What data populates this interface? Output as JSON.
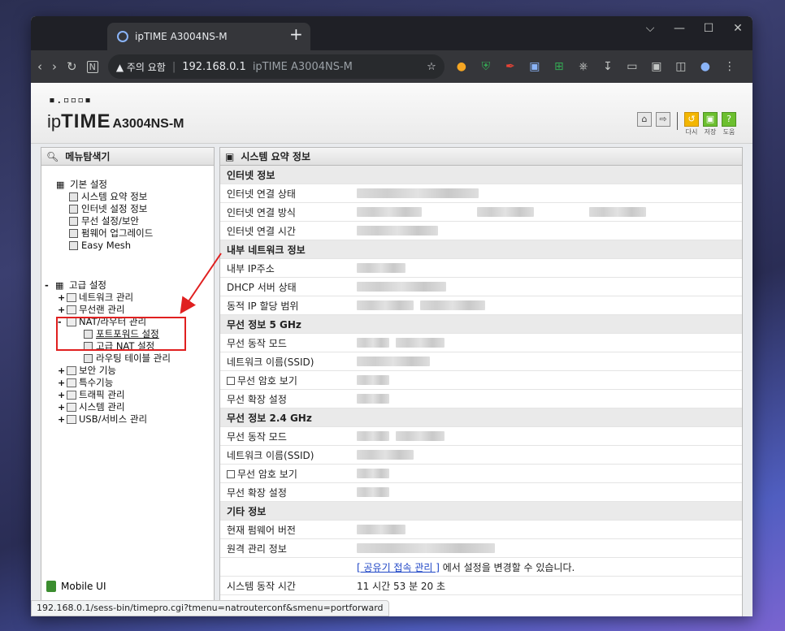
{
  "browser": {
    "tab_title": "ipTIME A3004NS-M",
    "new_tab": "+",
    "win_controls": [
      "⌵",
      "—",
      "☐",
      "✕"
    ],
    "address": {
      "warning": "▲ 주의 요함",
      "separator": "|",
      "host": "192.168.0.1",
      "page_title": "ipTIME A3004NS-M"
    },
    "status_url": "192.168.0.1/sess-bin/timepro.cgi?tmenu=natrouterconf&smenu=portforward"
  },
  "header": {
    "logo_dots": "▪.▫▫▫▪",
    "logo_ip": "ip",
    "logo_time": "TIME",
    "logo_model": "A3004NS-M",
    "buttons": [
      {
        "label": "다시"
      },
      {
        "label": "저장"
      },
      {
        "label": "도움"
      }
    ]
  },
  "left_panel": {
    "title": "메뉴탐색기",
    "basic_group": "기본 설정",
    "basic_items": [
      "시스템 요약 정보",
      "인터넷 설정 정보",
      "무선 설정/보안",
      "펌웨어 업그레이드",
      "Easy Mesh"
    ],
    "advanced_group": "고급 설정",
    "advanced_items": {
      "network": "네트워크 관리",
      "wireless": "무선랜 관리",
      "nat": "NAT/라우터 관리",
      "nat_sub": [
        "포트포워드 설정",
        "고급 NAT 설정",
        "라우팅 테이블 관리"
      ],
      "security": "보안 기능",
      "special": "특수기능",
      "traffic": "트래픽 관리",
      "system": "시스템 관리",
      "usb": "USB/서비스 관리"
    },
    "mobile_ui": "Mobile UI"
  },
  "right_panel": {
    "title": "시스템 요약 정보",
    "sections": {
      "internet": "인터넷 정보",
      "internet_rows": [
        "인터넷 연결 상태",
        "인터넷 연결 방식",
        "인터넷 연결 시간"
      ],
      "lan": "내부 네트워크 정보",
      "lan_rows": [
        "내부 IP주소",
        "DHCP 서버 상태",
        "동적 IP 할당 범위"
      ],
      "wifi5": "무선 정보 5 GHz",
      "wifi5_rows": [
        "무선 동작 모드",
        "네트워크 이름(SSID)",
        "무선 암호 보기",
        "무선 확장 설정"
      ],
      "wifi24": "무선 정보 2.4 GHz",
      "wifi24_rows": [
        "무선 동작 모드",
        "네트워크 이름(SSID)",
        "무선 암호 보기",
        "무선 확장 설정"
      ],
      "etc": "기타 정보",
      "etc_rows": [
        "현재 펌웨어 버전",
        "원격 관리 정보"
      ],
      "note_link": "[ 공유기 접속 관리 ]",
      "note_text": " 에서 설정을 변경할 수 있습니다.",
      "uptime_label": "시스템 동작 시간",
      "uptime_value": "11 시간 53 분 20 초"
    }
  }
}
